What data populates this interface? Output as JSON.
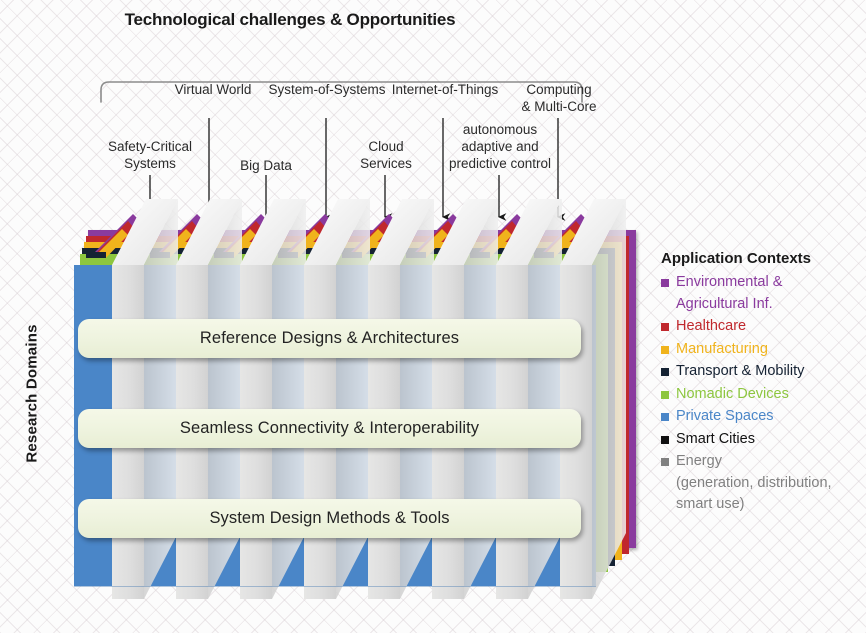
{
  "title": "Technological challenges & Opportunities",
  "side_label": "Research Domains",
  "top_labels": [
    {
      "text": "Safety-Critical\nSystems"
    },
    {
      "text": "Virtual World"
    },
    {
      "text": "Big Data"
    },
    {
      "text": "System-of-Systems"
    },
    {
      "text": "Cloud\nServices"
    },
    {
      "text": "Internet-of-Things"
    },
    {
      "text": "autonomous\nadaptive and\npredictive control"
    },
    {
      "text": "Computing\n& Multi-Core"
    }
  ],
  "research_domains": [
    {
      "label": "Reference Designs & Architectures"
    },
    {
      "label": "Seamless Connectivity & Interoperability"
    },
    {
      "label": "System Design Methods & Tools"
    }
  ],
  "legend": {
    "title": "Application Contexts",
    "items": [
      {
        "label": "Environmental &\nAgricultural Inf.",
        "color": "#8a3a9e"
      },
      {
        "label": "Healthcare",
        "color": "#c0282d"
      },
      {
        "label": "Manufacturing",
        "color": "#f0b31c"
      },
      {
        "label": "Transport & Mobility",
        "color": "#152233"
      },
      {
        "label": "Nomadic Devices",
        "color": "#8dc63f"
      },
      {
        "label": "Private Spaces",
        "color": "#4a86c8"
      },
      {
        "label": "Smart Cities",
        "color": "#111111"
      },
      {
        "label": "Energy\n(generation, distribution,\nsmart use)",
        "color": "#808080"
      }
    ]
  },
  "stack_layers": [
    {
      "name": "environmental-agricultural",
      "color": "#8a3a9e"
    },
    {
      "name": "healthcare",
      "color": "#c0282d"
    },
    {
      "name": "manufacturing",
      "color": "#f0b31c"
    },
    {
      "name": "transport-mobility",
      "color": "#152233"
    },
    {
      "name": "nomadic-devices",
      "color": "#8dc63f"
    },
    {
      "name": "private-spaces",
      "color": "#4a86c8"
    }
  ],
  "colors": {
    "panel_blue": "#4a86c8",
    "pillar_gray": "#dededd",
    "bar_cream": "#eef3de",
    "text_dark": "#231f20",
    "bracket_gray": "#8c8c8c"
  },
  "pillar_count": 8
}
